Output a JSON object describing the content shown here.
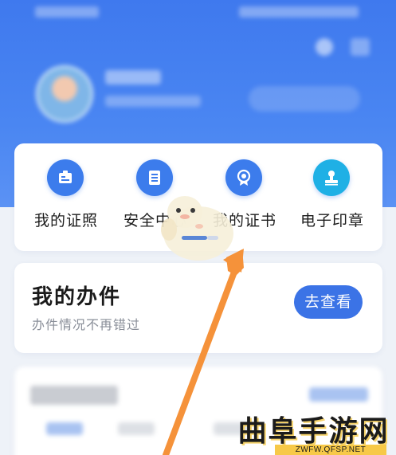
{
  "services": [
    {
      "label": "我的证照",
      "icon": "id-card-icon"
    },
    {
      "label": "安全中心",
      "icon": "document-list-icon"
    },
    {
      "label": "我的证书",
      "icon": "certificate-icon"
    },
    {
      "label": "电子印章",
      "icon": "stamp-icon"
    }
  ],
  "tasks": {
    "title": "我的办件",
    "subtitle": "办件情况不再错过",
    "button_label": "去查看"
  },
  "watermark": {
    "title": "曲阜手游网",
    "url": "ZWFW.QFSP.NET"
  },
  "colors": {
    "header_blue": "#4a86f2",
    "accent_blue": "#3b73e6",
    "arrow_orange": "#f5923a",
    "background": "#eef2f8"
  }
}
